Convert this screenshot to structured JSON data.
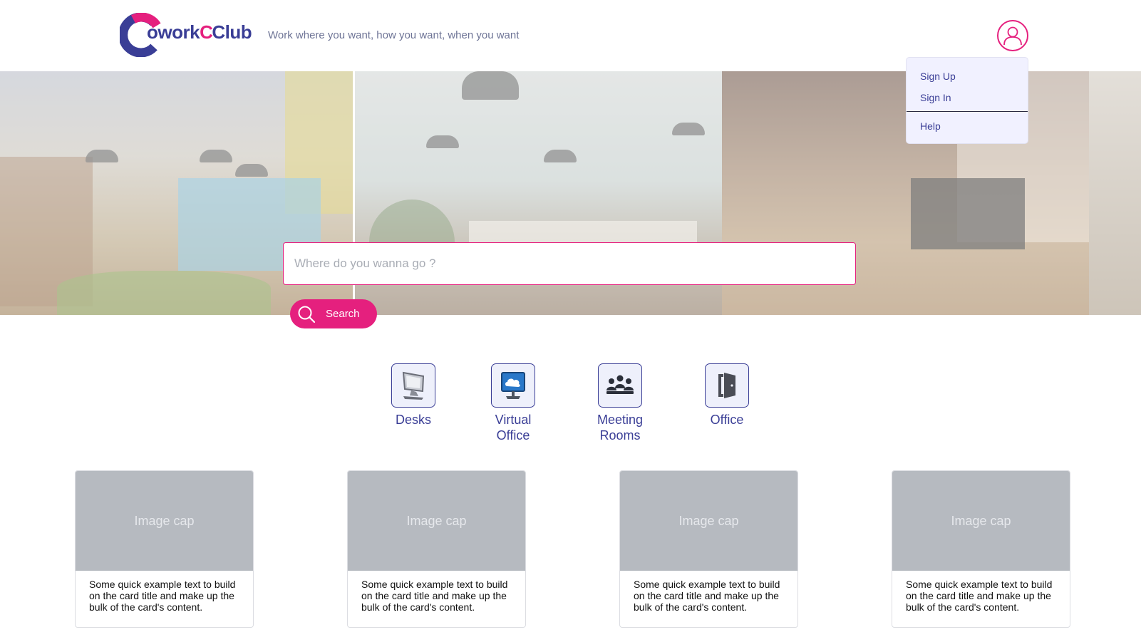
{
  "brand": {
    "logo_prefix": "C",
    "logo_word": "owork",
    "logo_suffix": "Club",
    "tagline": "Work where you want, how you want, when you want",
    "colors": {
      "primary": "#3a3e96",
      "accent": "#e5207e"
    }
  },
  "user_menu": {
    "icon": "user-icon",
    "items": [
      {
        "label": "Sign Up"
      },
      {
        "label": "Sign In"
      },
      {
        "label": "Help"
      }
    ]
  },
  "search": {
    "placeholder": "Where do you wanna go ?",
    "value": "",
    "button_label": "Search",
    "icon": "search-icon"
  },
  "categories": [
    {
      "label": "Desks",
      "icon": "computer-icon"
    },
    {
      "label": "Virtual Office",
      "icon": "cloud-monitor-icon"
    },
    {
      "label": "Meeting Rooms",
      "icon": "group-icon"
    },
    {
      "label": "Office",
      "icon": "door-icon"
    }
  ],
  "cards": [
    {
      "image_label": "Image cap",
      "text": "Some quick example text to build on the card title and make up the bulk of the card's content."
    },
    {
      "image_label": "Image cap",
      "text": "Some quick example text to build on the card title and make up the bulk of the card's content."
    },
    {
      "image_label": "Image cap",
      "text": "Some quick example text to build on the card title and make up the bulk of the card's content."
    },
    {
      "image_label": "Image cap",
      "text": "Some quick example text to build on the card title and make up the bulk of the card's content."
    }
  ]
}
